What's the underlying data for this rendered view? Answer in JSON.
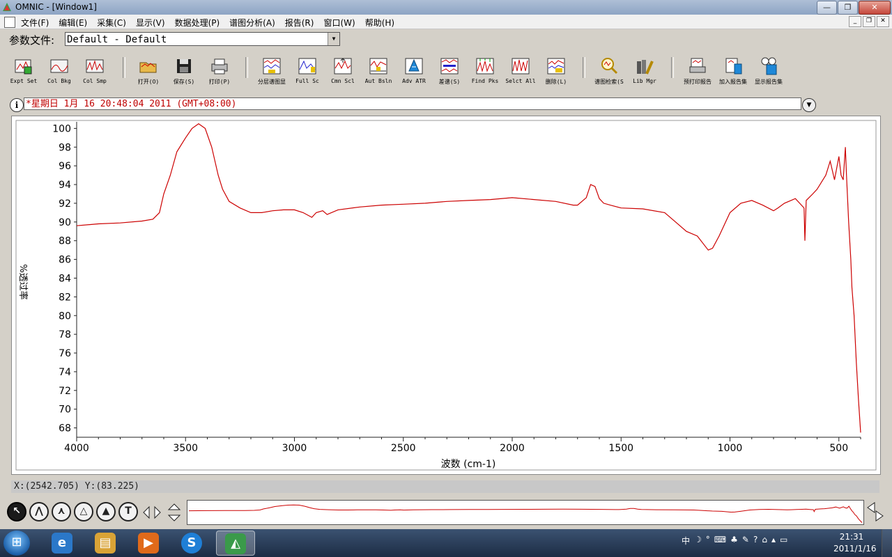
{
  "window": {
    "title": "OMNIC - [Window1]",
    "buttons": [
      "—",
      "❐",
      "✕"
    ]
  },
  "menu": {
    "items": [
      "文件(F)",
      "编辑(E)",
      "采集(C)",
      "显示(V)",
      "数据处理(P)",
      "谱图分析(A)",
      "报告(R)",
      "窗口(W)",
      "帮助(H)"
    ],
    "mdi_buttons": [
      "_",
      "❐",
      "✕"
    ]
  },
  "params": {
    "label": "参数文件:",
    "value": "Default - Default"
  },
  "toolbar": {
    "buttons": [
      {
        "label": "Expt Set",
        "icon": "experiment-setup-icon"
      },
      {
        "label": "Col Bkg",
        "icon": "collect-background-icon"
      },
      {
        "label": "Col Smp",
        "icon": "collect-sample-icon"
      },
      {
        "label": "打开(O)",
        "icon": "open-folder-icon"
      },
      {
        "label": "保存(S)",
        "icon": "save-disk-icon"
      },
      {
        "label": "打印(P)",
        "icon": "printer-icon"
      },
      {
        "label": "分层谱图显",
        "icon": "stack-spectra-icon"
      },
      {
        "label": "Full Sc",
        "icon": "full-scale-icon"
      },
      {
        "label": "Cmn Scl",
        "icon": "common-scale-icon"
      },
      {
        "label": "Aut Bsln",
        "icon": "auto-baseline-icon"
      },
      {
        "label": "Adv ATR",
        "icon": "advanced-atr-icon"
      },
      {
        "label": "差谱(S)",
        "icon": "subtract-spectra-icon"
      },
      {
        "label": "Find Pks",
        "icon": "find-peaks-icon"
      },
      {
        "label": "Selct All",
        "icon": "select-all-icon"
      },
      {
        "label": "删除(L)",
        "icon": "delete-spectrum-icon"
      },
      {
        "label": "谱图检索(S",
        "icon": "library-search-icon"
      },
      {
        "label": "Lib Mgr",
        "icon": "library-manager-icon"
      },
      {
        "label": "预打印报告",
        "icon": "print-preview-report-icon"
      },
      {
        "label": "加入报告集",
        "icon": "add-to-report-icon"
      },
      {
        "label": "显示报告集",
        "icon": "view-report-icon"
      }
    ]
  },
  "spectrum_title": "*星期日 1月 16 20:48:04 2011 (GMT+08:00)",
  "chart_data": {
    "type": "line",
    "title": "",
    "xlabel": "波数 (cm-1)",
    "ylabel": "%透过率",
    "xlim": [
      4000,
      400
    ],
    "ylim": [
      67,
      100.7
    ],
    "x_ticks": [
      4000,
      3500,
      3000,
      2500,
      2000,
      1500,
      1000,
      500
    ],
    "y_ticks": [
      68,
      70,
      72,
      74,
      76,
      78,
      80,
      82,
      84,
      86,
      88,
      90,
      92,
      94,
      96,
      98,
      100
    ],
    "grid": false,
    "series": [
      {
        "color": "#cc0000",
        "x": [
          4000,
          3900,
          3800,
          3700,
          3650,
          3620,
          3600,
          3570,
          3540,
          3500,
          3470,
          3440,
          3410,
          3380,
          3350,
          3330,
          3300,
          3250,
          3200,
          3150,
          3100,
          3050,
          3000,
          2960,
          2920,
          2900,
          2870,
          2850,
          2800,
          2700,
          2600,
          2500,
          2400,
          2300,
          2200,
          2100,
          2000,
          1900,
          1800,
          1720,
          1700,
          1660,
          1640,
          1620,
          1600,
          1580,
          1550,
          1500,
          1400,
          1300,
          1250,
          1200,
          1150,
          1100,
          1080,
          1050,
          1000,
          950,
          900,
          850,
          800,
          780,
          750,
          720,
          700,
          680,
          660,
          656,
          650,
          620,
          600,
          560,
          540,
          520,
          500,
          490,
          480,
          470,
          465,
          455,
          445,
          440,
          430,
          420,
          410,
          400
        ],
        "y": [
          89.6,
          89.8,
          89.9,
          90.1,
          90.3,
          91.0,
          93.0,
          95.0,
          97.5,
          99.0,
          100.0,
          100.5,
          100.0,
          98.0,
          95.0,
          93.5,
          92.2,
          91.5,
          91.0,
          91.0,
          91.2,
          91.3,
          91.3,
          91.0,
          90.5,
          91.0,
          91.2,
          90.8,
          91.3,
          91.6,
          91.8,
          91.9,
          92.0,
          92.2,
          92.3,
          92.4,
          92.6,
          92.4,
          92.2,
          91.8,
          91.8,
          92.6,
          94.0,
          93.8,
          92.5,
          92.0,
          91.8,
          91.5,
          91.4,
          91.0,
          90.0,
          89.0,
          88.5,
          87.0,
          87.2,
          88.5,
          91.0,
          92.0,
          92.3,
          91.8,
          91.2,
          91.5,
          92.0,
          92.3,
          92.5,
          92.0,
          91.5,
          88.0,
          92.3,
          93.0,
          93.5,
          95.0,
          96.5,
          94.5,
          97.0,
          95.0,
          94.5,
          98.0,
          95.0,
          90.0,
          86.0,
          83.0,
          80.0,
          75.0,
          71.0,
          67.5
        ]
      }
    ]
  },
  "cursor_readout": "X:(2542.705) Y:(83.225)",
  "bottom_tools": [
    {
      "symbol": "↖",
      "icon": "selection-tool-icon"
    },
    {
      "symbol": "⋀",
      "icon": "region-tool-icon"
    },
    {
      "symbol": "⋏",
      "icon": "peak-height-tool-icon"
    },
    {
      "symbol": "△",
      "icon": "peak-area-tool-icon"
    },
    {
      "symbol": "▲",
      "icon": "spectral-tool-icon"
    },
    {
      "symbol": "T",
      "icon": "annotation-text-tool-icon"
    }
  ],
  "taskbar": {
    "apps": [
      {
        "icon": "internet-explorer-icon",
        "symbol": "e",
        "color": "#2b78c9"
      },
      {
        "icon": "file-explorer-icon",
        "symbol": "▤",
        "color": "#d9a336"
      },
      {
        "icon": "media-player-icon",
        "symbol": "▶",
        "color": "#e06a1a"
      },
      {
        "icon": "sogou-input-icon",
        "symbol": "S",
        "color": "#1f7fd6"
      },
      {
        "icon": "omnic-app-icon",
        "symbol": "◭",
        "color": "#3a9a4a"
      }
    ],
    "tray": [
      "中",
      "☽",
      "°",
      "⌨",
      "♣",
      "✎",
      "?",
      "⌂",
      "▴",
      "▭"
    ],
    "time": "21:31",
    "date": "2011/1/16"
  }
}
